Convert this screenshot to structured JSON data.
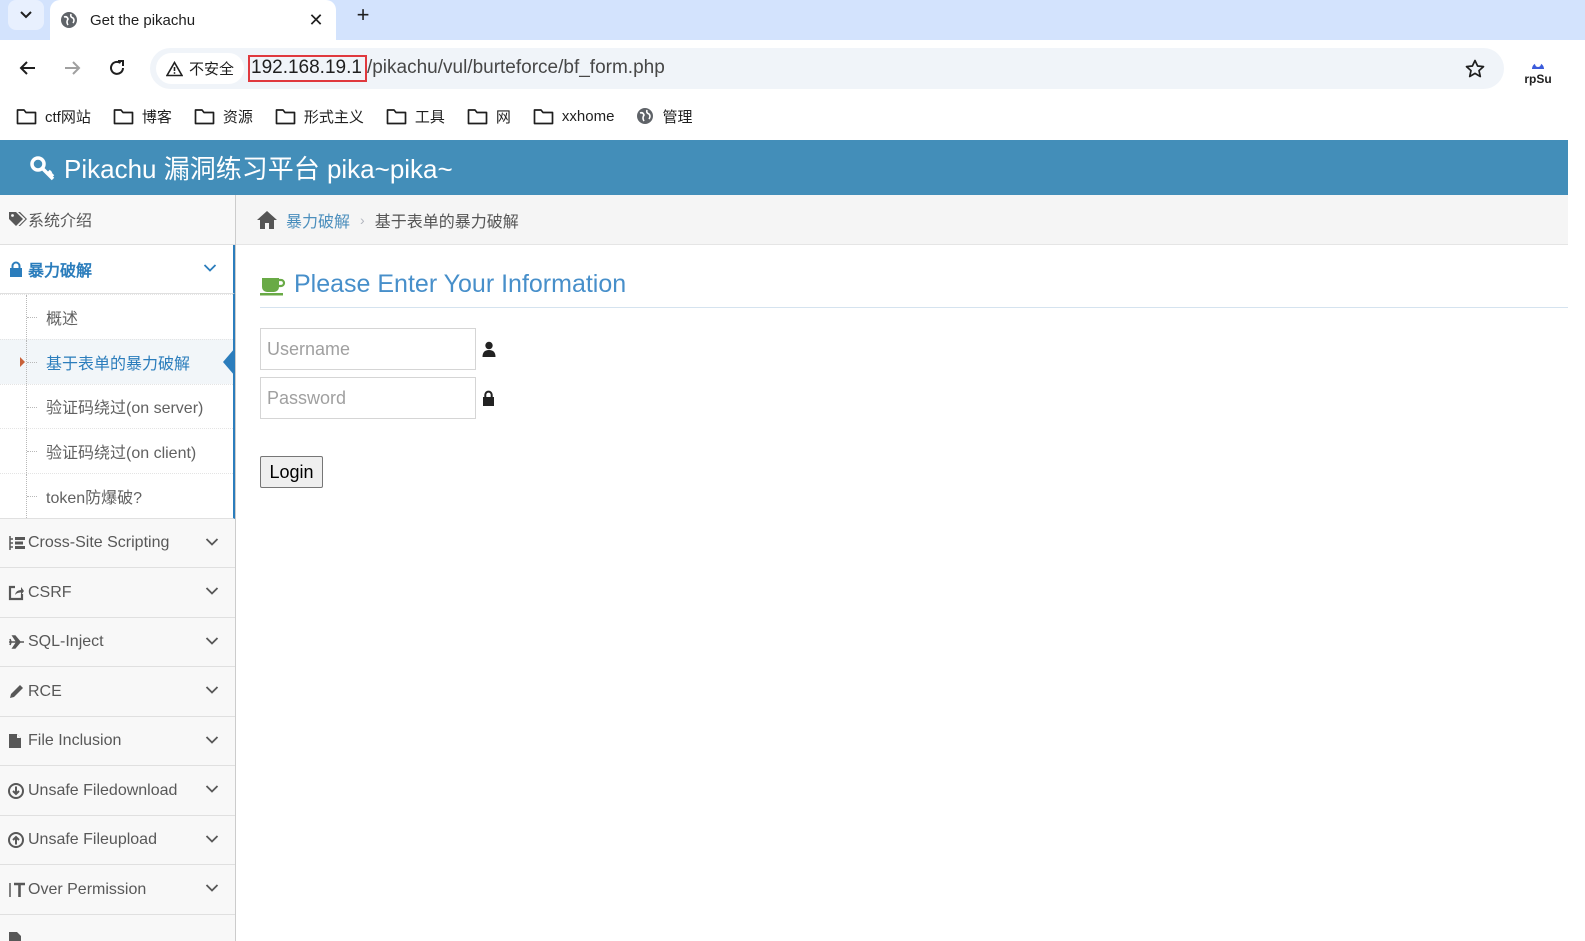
{
  "browser": {
    "tab_title": "Get the pikachu",
    "security_label": "不安全",
    "url_host": "192.168.19.1",
    "url_path": "/pikachu/vul/burteforce/bf_form.php",
    "profile_text": "rpSu",
    "bookmarks": [
      "ctf网站",
      "博客",
      "资源",
      "形式主义",
      "工具",
      "网",
      "xxhome",
      "管理"
    ]
  },
  "navbar": {
    "brand": "Pikachu 漏洞练习平台 pika~pika~"
  },
  "sidebar": {
    "intro": "系统介绍",
    "bruteforce": "暴力破解",
    "sub": [
      "概述",
      "基于表单的暴力破解",
      "验证码绕过(on server)",
      "验证码绕过(on client)",
      "token防爆破?"
    ],
    "items": [
      "Cross-Site Scripting",
      "CSRF",
      "SQL-Inject",
      "RCE",
      "File Inclusion",
      "Unsafe Filedownload",
      "Unsafe Fileupload",
      "Over Permission"
    ]
  },
  "breadcrumb": {
    "parent": "暴力破解",
    "current": "基于表单的暴力破解"
  },
  "form": {
    "title": "Please Enter Your Information",
    "username_placeholder": "Username",
    "password_placeholder": "Password",
    "login_label": "Login"
  }
}
